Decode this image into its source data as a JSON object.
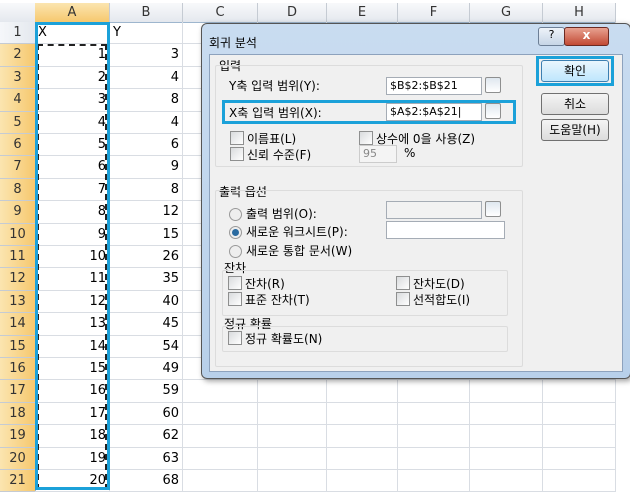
{
  "sheet": {
    "columns": [
      "A",
      "B",
      "C",
      "D",
      "E",
      "F",
      "G",
      "H"
    ],
    "header_row": {
      "A": "X",
      "B": "Y"
    },
    "rows": [
      [
        1,
        3
      ],
      [
        2,
        4
      ],
      [
        3,
        8
      ],
      [
        4,
        4
      ],
      [
        5,
        6
      ],
      [
        6,
        9
      ],
      [
        7,
        8
      ],
      [
        8,
        12
      ],
      [
        9,
        15
      ],
      [
        10,
        26
      ],
      [
        11,
        35
      ],
      [
        12,
        40
      ],
      [
        13,
        45
      ],
      [
        14,
        54
      ],
      [
        15,
        49
      ],
      [
        16,
        59
      ],
      [
        17,
        60
      ],
      [
        18,
        62
      ],
      [
        19,
        63
      ],
      [
        20,
        68
      ]
    ],
    "highlight_color": "#1ba1d9"
  },
  "dialog": {
    "title": "회귀 분석",
    "help": "?",
    "close": "x",
    "input_group": "입력",
    "y_range_label": "Y축 입력 범위(Y):",
    "y_range_value": "$B$2:$B$21",
    "x_range_label": "X축 입력 범위(X):",
    "x_range_value": "$A$2:$A$21|",
    "labels": "이름표(L)",
    "constant_zero": "상수에 0을 사용(Z)",
    "confidence": "신뢰 수준(F)",
    "confidence_value": "95",
    "percent": "%",
    "output_group": "출력 옵션",
    "output_range": "출력 범위(O):",
    "new_worksheet": "새로운 워크시트(P):",
    "new_workbook": "새로운 통합 문서(W)",
    "residuals_group": "잔차",
    "residuals": "잔차(R)",
    "std_residuals": "표준 잔차(T)",
    "residual_plots": "잔차도(D)",
    "line_fit": "선적합도(I)",
    "normal_group": "정규 확률",
    "normal_plot": "정규 확률도(N)",
    "ok": "확인",
    "cancel": "취소",
    "help_btn": "도움말(H)"
  }
}
